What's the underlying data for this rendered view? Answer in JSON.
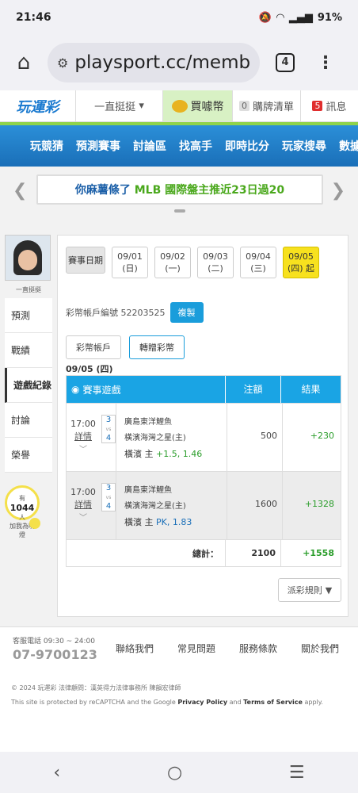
{
  "status": {
    "time": "21:46",
    "battery": "91%"
  },
  "browser": {
    "url": "playsport.cc/memb",
    "tab_count": "4"
  },
  "sitenav": {
    "logo": "玩運彩",
    "user_menu": "一直挺挺",
    "buy": "買噱幣",
    "cart_count": "0",
    "cart": "購牌清單",
    "msg_count": "5",
    "messages": "訊息"
  },
  "mainnav": [
    "玩競猜",
    "預測賽事",
    "討論區",
    "找高手",
    "即時比分",
    "玩家搜尋",
    "數據"
  ],
  "ticker": {
    "part1": "你麻薯條了",
    "part2": "MLB 國際盤主推近23日過20"
  },
  "sidebar": {
    "username": "一直挺挺",
    "items": [
      "預測",
      "戰績",
      "遊戲紀錄",
      "討論",
      "榮譽"
    ],
    "fans_prefix": "有",
    "fans_count": "1044",
    "fans_suffix": "人",
    "fans_label": "加我為明燈"
  },
  "dates": {
    "label": "賽事日期",
    "days": [
      {
        "date": "09/01",
        "dow": "(日)"
      },
      {
        "date": "09/02",
        "dow": "(一)"
      },
      {
        "date": "09/03",
        "dow": "(二)"
      },
      {
        "date": "09/04",
        "dow": "(三)"
      },
      {
        "date": "09/05",
        "dow": "(四) 起"
      }
    ]
  },
  "account": {
    "label": "彩幣帳戶編號 52203525",
    "copy": "複製"
  },
  "subtabs": [
    "彩幣帳戶",
    "轉贈彩幣"
  ],
  "day_title": "09/05 (四)",
  "table": {
    "headers": {
      "game": "賽事遊戲",
      "bet": "注額",
      "result": "結果"
    },
    "rows": [
      {
        "time": "17:00",
        "detail": "詳情",
        "score_a": "3",
        "vs": "vs",
        "score_b": "4",
        "team_a": "廣島東洋鯉魚",
        "team_b": "橫濱海灣之星(主)",
        "pick": "橫濱 主",
        "odds": "+1.5, 1.46",
        "amount": "500",
        "result": "+230"
      },
      {
        "time": "17:00",
        "detail": "詳情",
        "score_a": "3",
        "vs": "vs",
        "score_b": "4",
        "team_a": "廣島東洋鯉魚",
        "team_b": "橫濱海灣之星(主)",
        "pick": "橫濱 主",
        "odds": "PK, 1.83",
        "amount": "1600",
        "result": "+1328"
      }
    ],
    "total_label": "總計：",
    "total_amount": "2100",
    "total_result": "+1558"
  },
  "rules_button": "派彩規則",
  "footer": {
    "phone_label": "客服電話 09:30 ~ 24:00",
    "phone": "07-9700123",
    "links": [
      "聯絡我們",
      "常見問題",
      "服務條款",
      "關於我們"
    ],
    "copyright": "© 2024 玩運彩 法律顧問：漢英得力法律事務所 陳韻宏律師",
    "recaptcha_pre": "This site is protected by reCAPTCHA and the Google",
    "privacy": "Privacy Policy",
    "and": "and",
    "terms": "Terms of Service",
    "apply": "apply."
  },
  "colors": {
    "accent": "#1aa4e4",
    "selected_date": "#f7e11e",
    "positive": "#2a9d2a"
  }
}
